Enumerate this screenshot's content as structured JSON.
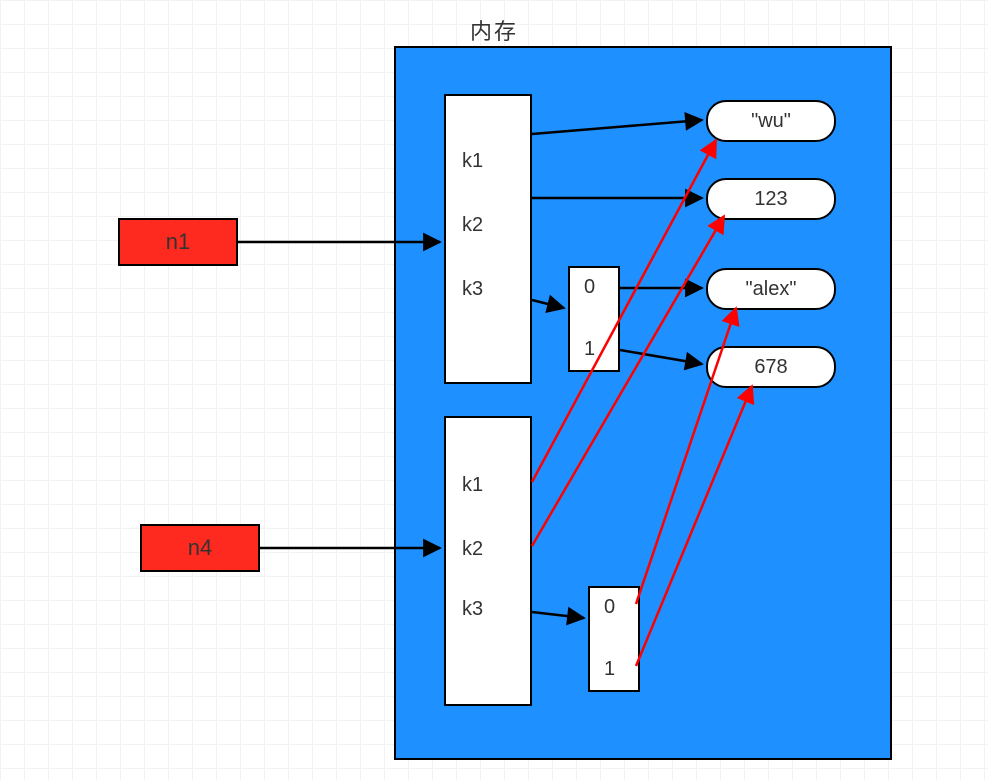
{
  "title": "内存",
  "vars": {
    "n1": "n1",
    "n4": "n4"
  },
  "dict1": {
    "k1": "k1",
    "k2": "k2",
    "k3": "k3"
  },
  "dict2": {
    "k1": "k1",
    "k2": "k2",
    "k3": "k3"
  },
  "list1": {
    "i0": "0",
    "i1": "1"
  },
  "list2": {
    "i0": "0",
    "i1": "1"
  },
  "vals": {
    "wu": "\"wu\"",
    "v123": "123",
    "alex": "\"alex\"",
    "v678": "678"
  },
  "colors": {
    "memory": "#1e90ff",
    "var": "#ff2a1f",
    "arrowBlack": "#000000",
    "arrowRed": "#ff0000"
  },
  "chart_data": {
    "type": "graph",
    "description": "Python-style memory diagram: two variable names reference two dict objects that share underlying value objects",
    "nodes": [
      {
        "id": "n1",
        "kind": "name",
        "label": "n1"
      },
      {
        "id": "n4",
        "kind": "name",
        "label": "n4"
      },
      {
        "id": "d1",
        "kind": "dict",
        "keys": [
          "k1",
          "k2",
          "k3"
        ]
      },
      {
        "id": "d2",
        "kind": "dict",
        "keys": [
          "k1",
          "k2",
          "k3"
        ]
      },
      {
        "id": "l1",
        "kind": "list",
        "indices": [
          0,
          1
        ]
      },
      {
        "id": "l2",
        "kind": "list",
        "indices": [
          0,
          1
        ]
      },
      {
        "id": "wu",
        "kind": "str",
        "value": "wu"
      },
      {
        "id": "v123",
        "kind": "int",
        "value": 123
      },
      {
        "id": "alex",
        "kind": "str",
        "value": "alex"
      },
      {
        "id": "v678",
        "kind": "int",
        "value": 678
      }
    ],
    "edges": [
      {
        "from": "n1",
        "to": "d1",
        "color": "black"
      },
      {
        "from": "n4",
        "to": "d2",
        "color": "black"
      },
      {
        "from": "d1.k1",
        "to": "wu",
        "color": "black"
      },
      {
        "from": "d1.k2",
        "to": "v123",
        "color": "black"
      },
      {
        "from": "d1.k3",
        "to": "l1",
        "color": "black"
      },
      {
        "from": "l1.0",
        "to": "alex",
        "color": "black"
      },
      {
        "from": "l1.1",
        "to": "v678",
        "color": "black"
      },
      {
        "from": "d2.k1",
        "to": "wu",
        "color": "red"
      },
      {
        "from": "d2.k2",
        "to": "v123",
        "color": "red"
      },
      {
        "from": "d2.k3",
        "to": "l2",
        "color": "black"
      },
      {
        "from": "l2.0",
        "to": "alex",
        "color": "red"
      },
      {
        "from": "l2.1",
        "to": "v678",
        "color": "red"
      }
    ]
  }
}
